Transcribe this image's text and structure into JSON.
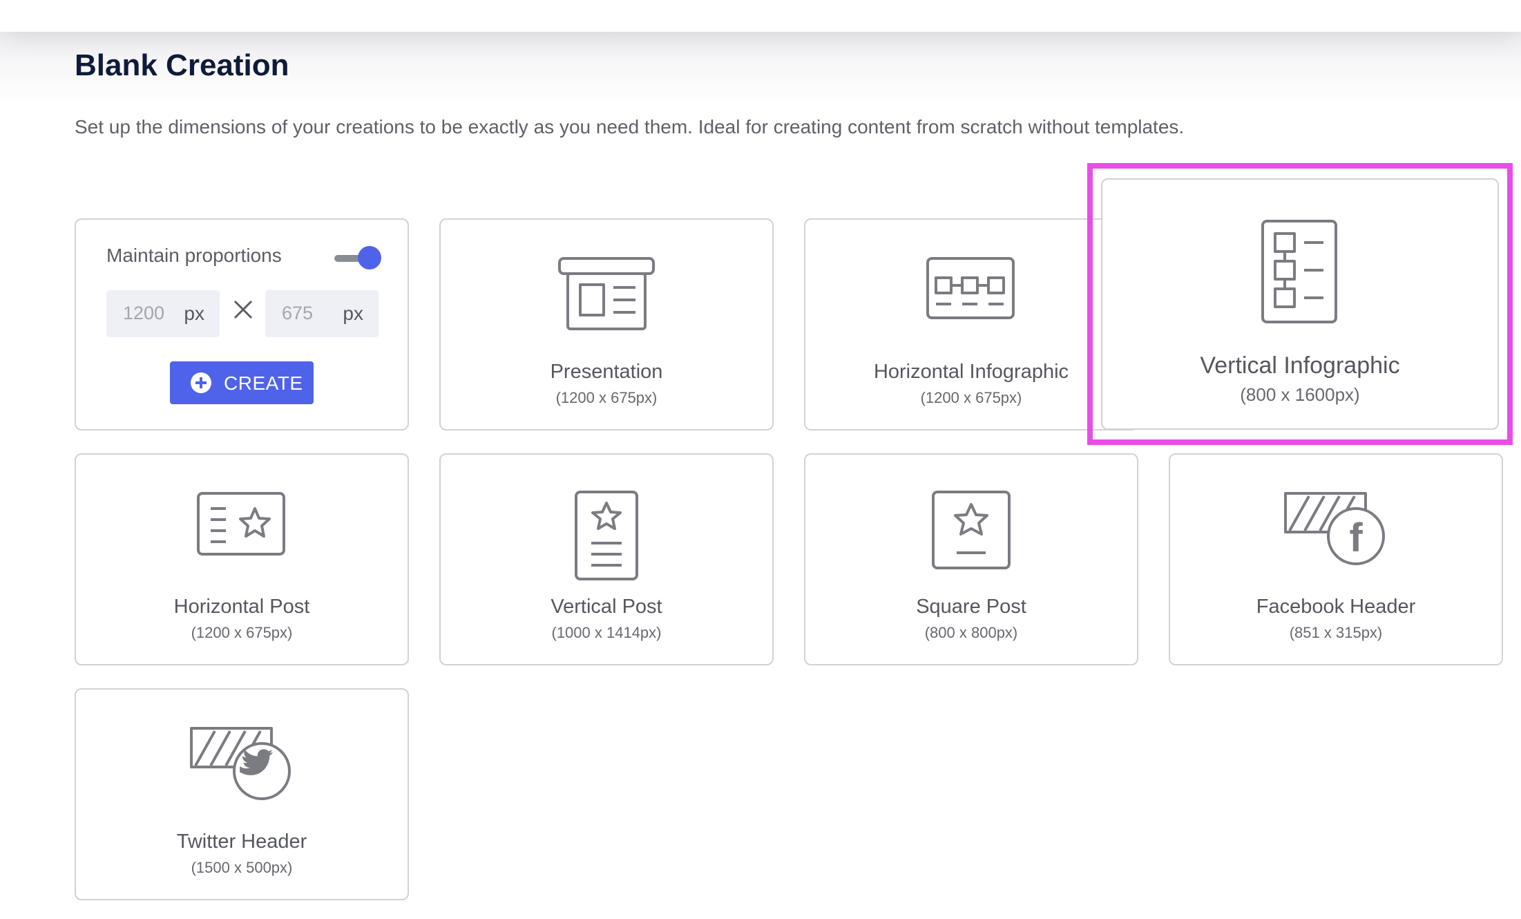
{
  "page": {
    "title": "Blank Creation",
    "description": "Set up the dimensions of your creations to be exactly as you need them. Ideal for creating content from scratch without templates."
  },
  "custom": {
    "maintain_label": "Maintain proportions",
    "maintain_on": true,
    "width_value": "1200",
    "height_value": "675",
    "unit": "px",
    "create_label": "CREATE"
  },
  "formats": [
    {
      "name": "Presentation",
      "size": "(1200 x 675px)",
      "icon": "presentation-icon"
    },
    {
      "name": "Horizontal Infographic",
      "size": "(1200 x 675px)",
      "icon": "horizontal-infographic-icon"
    },
    {
      "name": "Vertical Infographic",
      "size": "(800 x 1600px)",
      "icon": "vertical-infographic-icon"
    },
    {
      "name": "Horizontal Post",
      "size": "(1200 x 675px)",
      "icon": "horizontal-post-icon"
    },
    {
      "name": "Vertical Post",
      "size": "(1000 x 1414px)",
      "icon": "vertical-post-icon"
    },
    {
      "name": "Square Post",
      "size": "(800 x 800px)",
      "icon": "square-post-icon"
    },
    {
      "name": "Facebook Header",
      "size": "(851 x 315px)",
      "icon": "facebook-header-icon"
    },
    {
      "name": "Twitter Header",
      "size": "(1500 x 500px)",
      "icon": "twitter-header-icon"
    }
  ],
  "colors": {
    "accent": "#4f63ea",
    "highlight": "#e94de9",
    "icon_stroke": "#7b7c82",
    "title": "#0f1b3a"
  }
}
